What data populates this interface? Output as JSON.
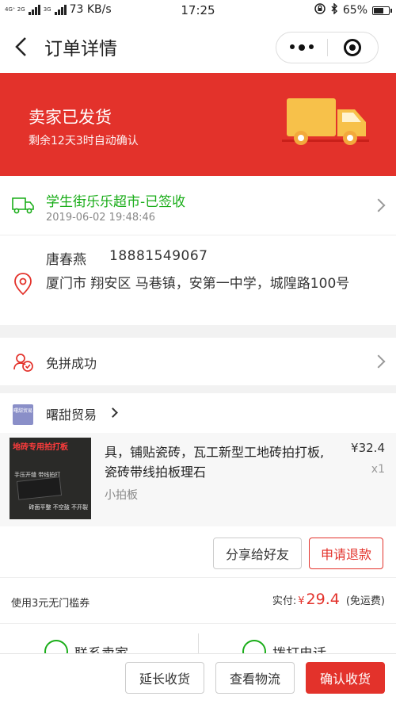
{
  "status_bar": {
    "network": "4G⁺ 2G",
    "network2": "3G",
    "speed": "73 KB/s",
    "time": "17:25",
    "battery": "65%"
  },
  "nav": {
    "title": "订单详情"
  },
  "banner": {
    "title": "卖家已发货",
    "subtitle": "剩余12天3时自动确认",
    "accent_color": "#e3322b"
  },
  "logistics": {
    "status": "学生街乐乐超市-已签收",
    "time": "2019-06-02 19:48:46",
    "status_color": "#1aad19"
  },
  "address": {
    "name": "唐春燕",
    "phone": "18881549067",
    "line": "厦门市 翔安区 马巷镇，安第一中学，城隍路100号"
  },
  "group_buy": {
    "label": "免拼成功"
  },
  "shop": {
    "logo_text": "曙甜贸易",
    "name": "曙甜贸易"
  },
  "product": {
    "image_text_top": "地砖专用拍打板",
    "image_text_mid": "手压开缝  带线拍打",
    "image_text_bottom": "砖面平整 不空鼓 不开裂",
    "title": "具，铺贴瓷砖，瓦工新型工地砖拍打板,瓷砖带线拍板理石",
    "spec": "小拍板",
    "price": "¥32.4",
    "qty": "x1"
  },
  "actions": {
    "share": "分享给好友",
    "refund": "申请退款"
  },
  "payment": {
    "coupon": "使用3元无门槛券",
    "paid_label": "实付:",
    "currency": "¥",
    "amount": "29.4",
    "shipping": "(免运费)"
  },
  "contact": {
    "seller": "联系卖家",
    "call": "拨打电话"
  },
  "bottom_bar": {
    "extend": "延长收货",
    "view_logistics": "查看物流",
    "confirm": "确认收货"
  }
}
